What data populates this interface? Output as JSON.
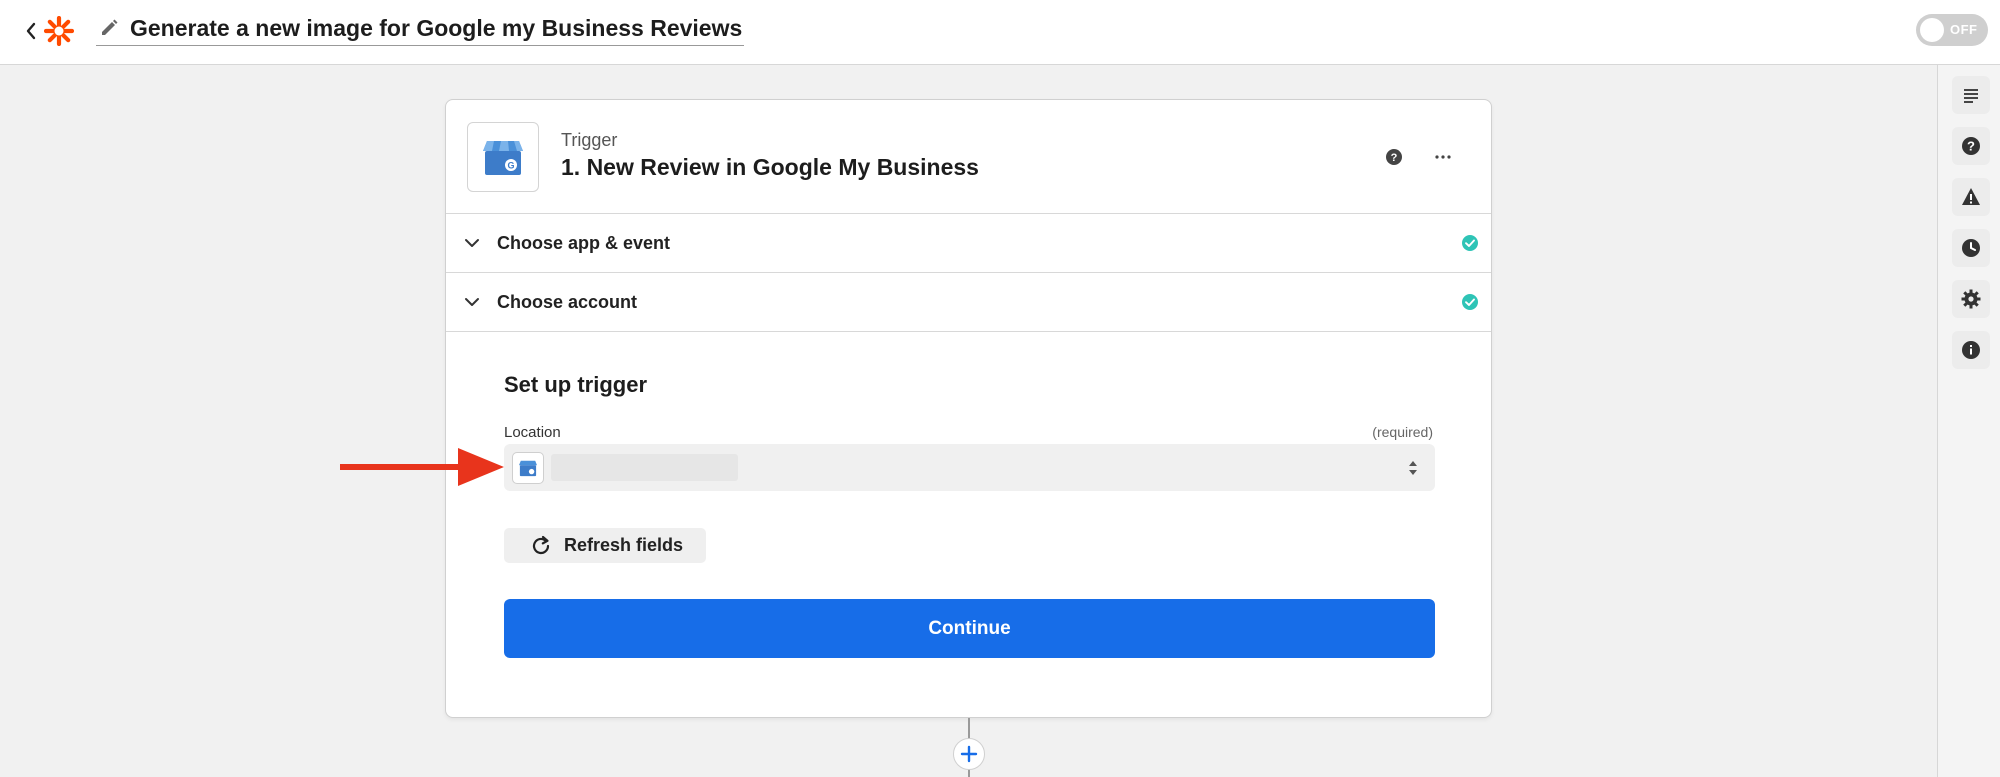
{
  "header": {
    "zap_title": "Generate a new image for Google my Business Reviews",
    "toggle_label": "OFF"
  },
  "step": {
    "kind": "Trigger",
    "title": "1. New Review in Google My Business",
    "app_icon": "google-my-business-icon"
  },
  "sections": [
    {
      "label": "Choose app & event",
      "complete": true
    },
    {
      "label": "Choose account",
      "complete": true
    }
  ],
  "setup": {
    "title": "Set up trigger",
    "field_label": "Location",
    "field_required": "(required)",
    "refresh_label": "Refresh fields",
    "continue_label": "Continue"
  },
  "sidebar": {
    "icons": [
      "notes-icon",
      "help-icon",
      "warning-icon",
      "history-icon",
      "settings-icon",
      "info-icon"
    ]
  },
  "colors": {
    "brand": "#ff4a00",
    "primary": "#176de8",
    "success": "#2ec4b6",
    "annotation": "#e8341c"
  }
}
